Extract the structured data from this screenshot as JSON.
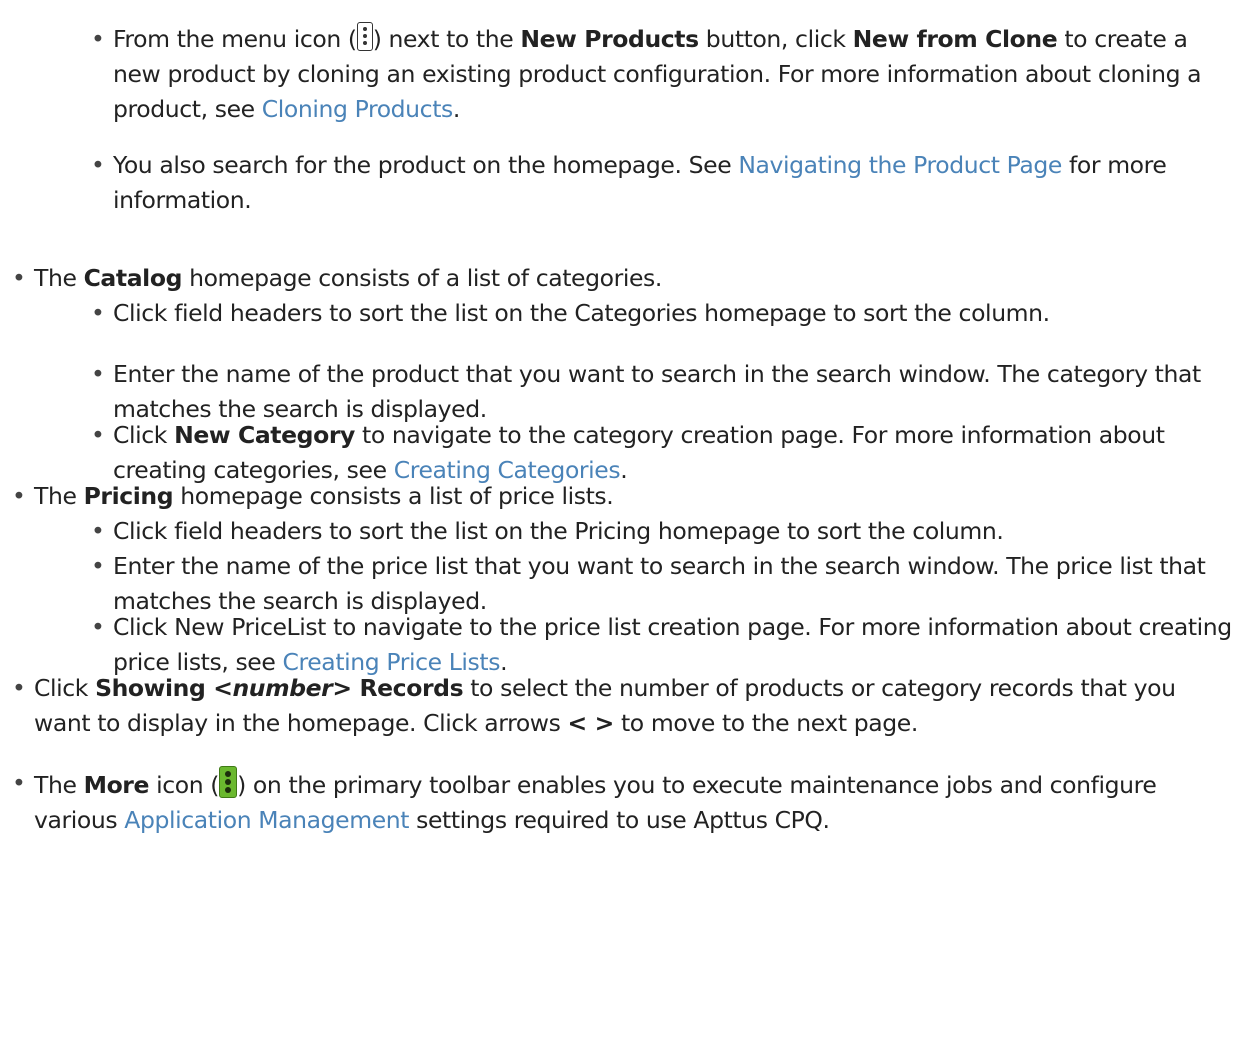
{
  "bullet": "•",
  "items": [
    {
      "p1": "From the menu icon (",
      "p2": ") next to the ",
      "b1": "New Products",
      "p3": " button, click ",
      "b2": "New from Clone",
      "p4": " to create a new product by cloning an existing product configuration. For more information about cloning a product, see ",
      "link": "Cloning Products",
      "p5": "."
    },
    {
      "p1": "You also search for the product on the homepage. See ",
      "link": "Navigating the Product Page",
      "p2": " for more information."
    },
    {
      "p1": "The ",
      "b1": "Catalog",
      "p2": " homepage consists of a list of categories."
    },
    {
      "p1": "Click field headers to sort the list on the Categories homepage to sort the column."
    },
    {
      "p1": "Enter the name of the product that you want to search in the search window. The category that matches the search is displayed."
    },
    {
      "p1": "Click ",
      "b1": "New Category",
      "p2": " to navigate to the category creation page. For more information about creating categories, see ",
      "link": "Creating Categories",
      "p3": "."
    },
    {
      "p1": "The ",
      "b1": "Pricing",
      "p2": " homepage consists a list of price lists."
    },
    {
      "p1": "Click field headers to sort the list on the Pricing homepage to sort the column."
    },
    {
      "p1": "Enter the name of the price list that you want to search in the search window. The price list that matches the search is displayed."
    },
    {
      "p1": "Click New PriceList to navigate to the price list creation page. For more information about creating price lists, see ",
      "link": "Creating Price Lists",
      "p2": "."
    },
    {
      "p1": "Click ",
      "b1": "Showing ",
      "em": "<number>",
      "b2": " Records",
      "p2": " to select the number of products or category records that you want to display in the homepage. Click arrows ",
      "b3": "< >",
      "p3": " to move to the next page."
    },
    {
      "p1": "The ",
      "b1": "More",
      "p2": " icon (",
      "p3": ") on the primary toolbar enables you to execute maintenance jobs and configure various ",
      "link": "Application Management",
      "p4": " settings required to use Apttus CPQ."
    }
  ],
  "icons": {
    "menu": "vertical-ellipsis-menu-icon",
    "more": "more-vertical-ellipsis-green-icon"
  },
  "colors": {
    "link": "#4a83b8",
    "more_icon": "#6ab82e"
  }
}
